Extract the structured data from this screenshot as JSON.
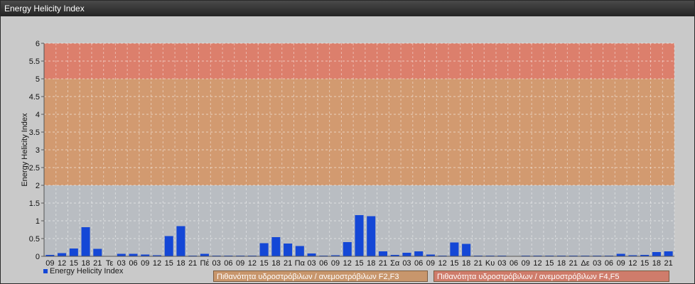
{
  "window": {
    "title": "Energy Helicity Index"
  },
  "legend": {
    "series_label": "Energy Helicity Index",
    "band1_label": "Πιθανότητα υδροστρόβιλων / ανεμοστρόβιλων F2,F3",
    "band2_label": "Πιθανότητα υδροστρόβιλων / ανεμοστρόβιλων F4,F5"
  },
  "colors": {
    "bar": "#1447d6",
    "band_low": "#b9bdc2",
    "band_mid": "#d29a70",
    "band_high": "#dc7f6c",
    "band1_legend": "#c8966c",
    "band2_legend": "#cf7c6b"
  },
  "chart_data": {
    "type": "bar",
    "ylabel": "Energy Helicity Index",
    "ylim": [
      0,
      6
    ],
    "yticks": [
      "0",
      "0.5",
      "1",
      "1.5",
      "2",
      "2.5",
      "3",
      "3.5",
      "4",
      "4.5",
      "5",
      "5.5",
      "6"
    ],
    "bands": [
      {
        "from": 0,
        "to": 2
      },
      {
        "from": 2,
        "to": 5
      },
      {
        "from": 5,
        "to": 6
      }
    ],
    "categories": [
      "09",
      "12",
      "15",
      "18",
      "21",
      "Τε",
      "03",
      "06",
      "09",
      "12",
      "15",
      "18",
      "21",
      "Πέ",
      "03",
      "06",
      "09",
      "12",
      "15",
      "18",
      "21",
      "Πα",
      "03",
      "06",
      "09",
      "12",
      "15",
      "18",
      "21",
      "Σα",
      "03",
      "06",
      "09",
      "12",
      "15",
      "18",
      "21",
      "Κυ",
      "03",
      "06",
      "09",
      "12",
      "15",
      "18",
      "21",
      "Δε",
      "03",
      "06",
      "09",
      "12",
      "15",
      "18",
      "21"
    ],
    "series": [
      {
        "name": "Energy Helicity Index",
        "values": [
          0.04,
          0.09,
          0.22,
          0.82,
          0.21,
          0.01,
          0.07,
          0.07,
          0.05,
          0.03,
          0.57,
          0.85,
          0.02,
          0.07,
          0.02,
          0.02,
          0.02,
          0.02,
          0.37,
          0.54,
          0.36,
          0.29,
          0.08,
          0.02,
          0.03,
          0.4,
          1.16,
          1.13,
          0.14,
          0.04,
          0.1,
          0.14,
          0.05,
          0.02,
          0.39,
          0.35,
          0.02,
          0.02,
          0.02,
          0.01,
          0.02,
          0.02,
          0.02,
          0.02,
          0.02,
          0.02,
          0.02,
          0.02,
          0.07,
          0.03,
          0.04,
          0.12,
          0.14
        ]
      }
    ],
    "grid": true
  }
}
